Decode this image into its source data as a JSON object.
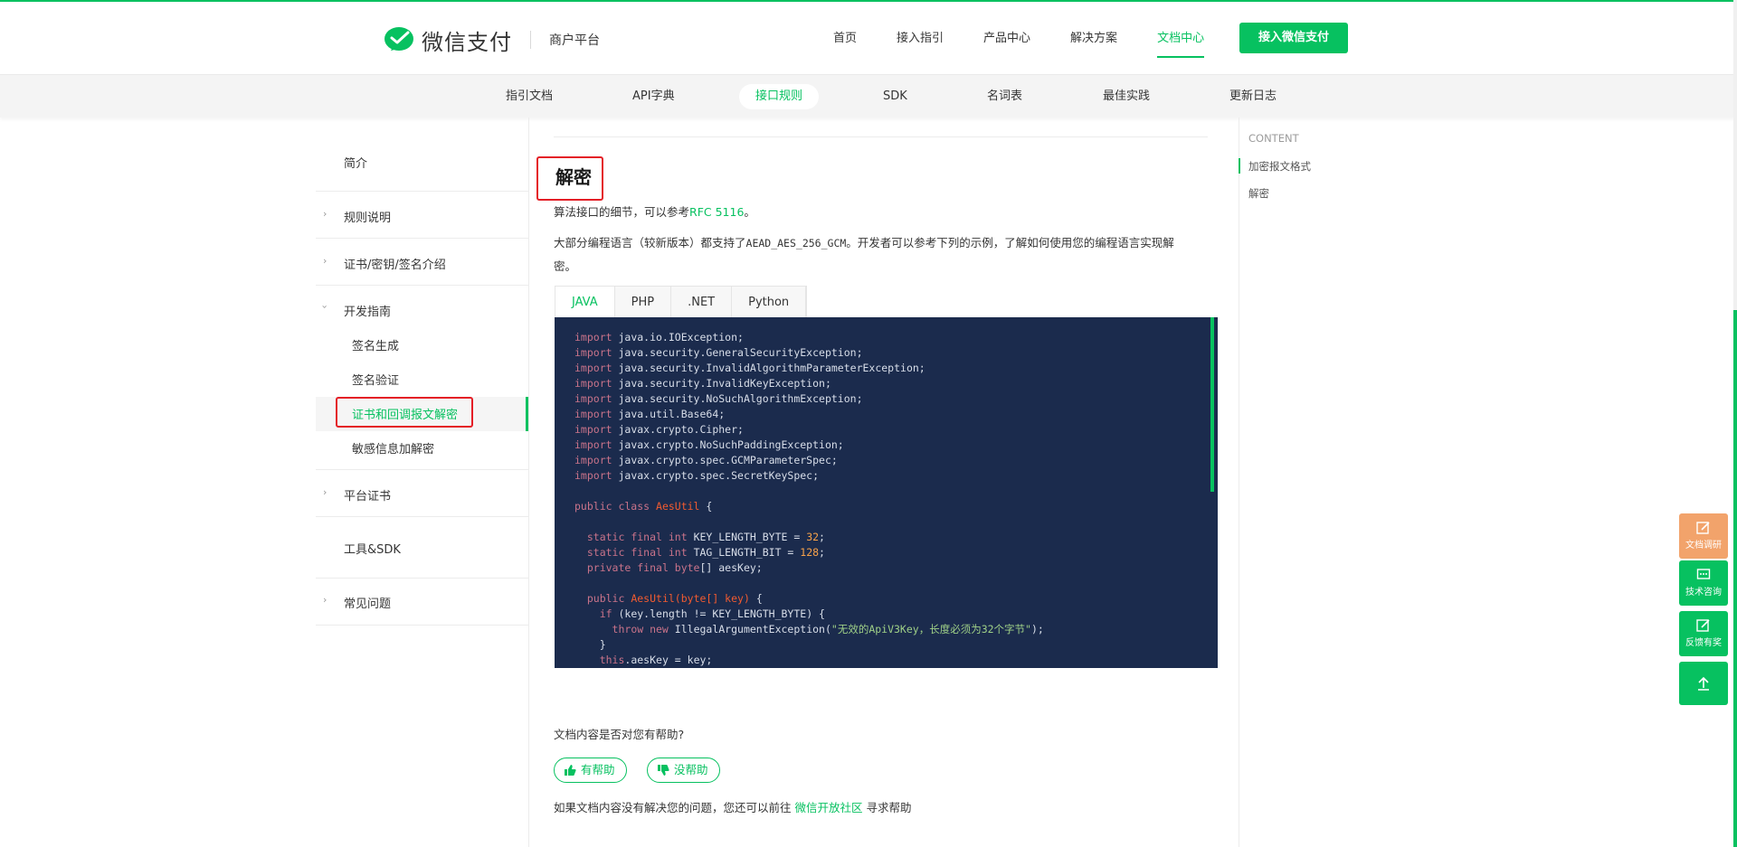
{
  "header": {
    "brand": "微信支付",
    "sub_brand": "商户平台",
    "nav": [
      "首页",
      "接入指引",
      "产品中心",
      "解决方案",
      "文档中心"
    ],
    "active_nav": "文档中心",
    "cta": "接入微信支付"
  },
  "sub_nav": {
    "items": [
      "指引文档",
      "API字典",
      "接口规则",
      "SDK",
      "名词表",
      "最佳实践",
      "更新日志"
    ],
    "active": "接口规则"
  },
  "sidebar": {
    "items": [
      "简介",
      "规则说明",
      "证书/密钥/签名介绍",
      "开发指南",
      "签名生成",
      "签名验证",
      "证书和回调报文解密",
      "敏感信息加解密",
      "平台证书",
      "工具&SDK",
      "常见问题"
    ],
    "active": "证书和回调报文解密"
  },
  "main": {
    "title": "解密",
    "para1_prefix": "算法接口的细节，可以参考",
    "para1_link": "RFC 5116",
    "para1_suffix": "。",
    "para2_prefix": "大部分编程语言（较新版本）都支持了",
    "para2_code": "AEAD_AES_256_GCM",
    "para2_suffix": "。开发者可以参考下列的示例，了解如何使用您的编程语言实现解",
    "para2_line2": "密。",
    "tabs": [
      "JAVA",
      "PHP",
      ".NET",
      "Python"
    ],
    "active_tab": "JAVA",
    "feedback_question": "文档内容是否对您有帮助?",
    "helpful": "有帮助",
    "not_helpful": "没帮助",
    "help_prefix": "如果文档内容没有解决您的问题，您还可以前往",
    "help_link": "微信开放社区",
    "help_suffix": "寻求帮助"
  },
  "code": {
    "imports": [
      "import java.io.IOException;",
      "import java.security.GeneralSecurityException;",
      "import java.security.InvalidAlgorithmParameterException;",
      "import java.security.InvalidKeyException;",
      "import java.security.NoSuchAlgorithmException;",
      "import java.util.Base64;",
      "import javax.crypto.Cipher;",
      "import javax.crypto.NoSuchPaddingException;",
      "import javax.crypto.spec.GCMParameterSpec;",
      "import javax.crypto.spec.SecretKeySpec;"
    ],
    "class_kw": "public class ",
    "class_name": "AesUtil",
    "class_open": " {",
    "field1_kw": "static final int ",
    "field1": "KEY_LENGTH_BYTE = ",
    "field1_val": "32",
    "field2_kw": "static final int ",
    "field2": "TAG_LENGTH_BIT = ",
    "field2_val": "128",
    "field3_kw": "private final byte",
    "field3": "[] aesKey;",
    "ctor_kw": "public ",
    "ctor_name": "AesUtil",
    "ctor_params": "(byte[] key)",
    "ctor_open": " {",
    "if_kw": "if ",
    "if_cond": "(key.length != KEY_LENGTH_BYTE) {",
    "throw_kw": "throw new ",
    "throw_cls": "IllegalArgumentException(",
    "throw_msg": "\"无效的ApiV3Key，长度必须为32个字节\"",
    "throw_end": ");",
    "close": "}",
    "this_kw": "this",
    "this_rest": ".aesKey = key;"
  },
  "toc": {
    "heading": "CONTENT",
    "items": [
      "加密报文格式",
      "解密"
    ],
    "active": "加密报文格式"
  },
  "float_buttons": {
    "survey": "文档调研",
    "consult": "技术咨询",
    "feedback": "反馈有奖"
  },
  "colors": {
    "brand_green": "#07c160",
    "code_bg": "#1b2b4d",
    "highlight_red": "#e41e26",
    "survey_orange": "#f2a36b"
  }
}
